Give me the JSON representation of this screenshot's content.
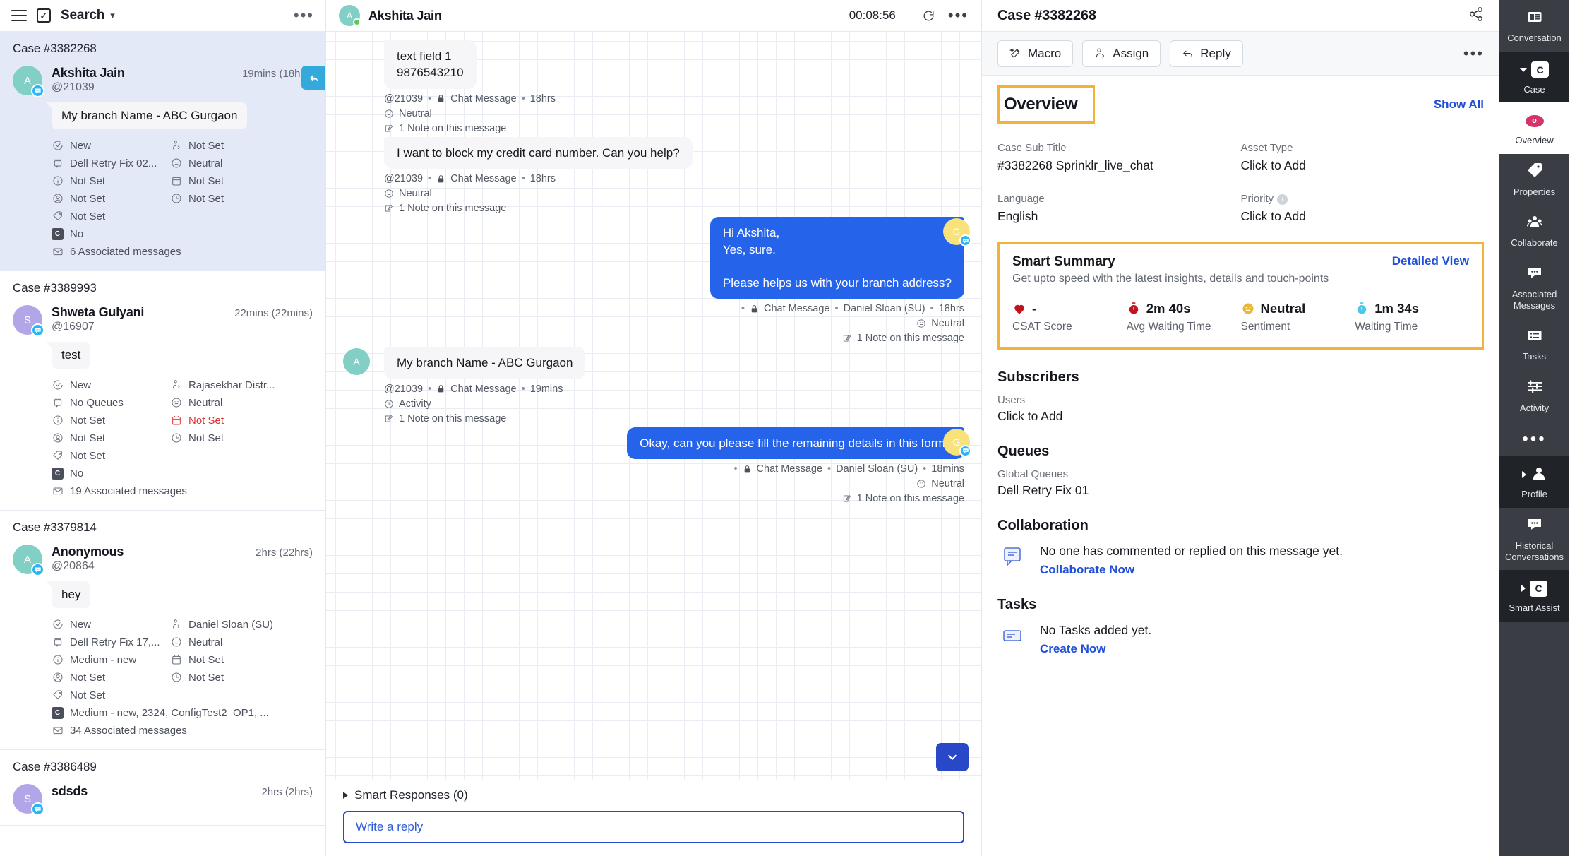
{
  "left": {
    "topbar": {
      "search_label": "Search"
    },
    "cases": [
      {
        "case_id": "Case #3382268",
        "name": "Akshita Jain",
        "handle": "@21039",
        "time": "19mins (18hrs)",
        "initial": "A",
        "avatar_color": "#82cfc6",
        "message": "My branch Name - ABC Gurgaon",
        "meta_left": [
          "New",
          "Dell Retry Fix 02...",
          "Not Set",
          "Not Set",
          "Not Set"
        ],
        "meta_right": [
          "Not Set",
          "Neutral",
          "Not Set",
          "Not Set"
        ],
        "consent": "No",
        "associated": "6 Associated messages",
        "selected": true
      },
      {
        "case_id": "Case #3389993",
        "name": "Shweta Gulyani",
        "handle": "@16907",
        "time": "22mins (22mins)",
        "initial": "S",
        "avatar_color": "#b3a6e8",
        "message": "test",
        "meta_left": [
          "New",
          "No Queues",
          "Not Set",
          "Not Set",
          "Not Set"
        ],
        "meta_right": [
          "Rajasekhar Distr...",
          "Neutral",
          "Not Set",
          "Not Set"
        ],
        "meta_right_red_index": 2,
        "consent": "No",
        "associated": "19 Associated messages",
        "selected": false
      },
      {
        "case_id": "Case #3379814",
        "name": "Anonymous",
        "handle": "@20864",
        "time": "2hrs (22hrs)",
        "initial": "A",
        "avatar_color": "#82cfc6",
        "message": "hey",
        "meta_left": [
          "New",
          "Dell Retry Fix 17,...",
          "Medium - new",
          "Not Set",
          "Not Set"
        ],
        "meta_right": [
          "Daniel Sloan (SU)",
          "Neutral",
          "Not Set",
          "Not Set"
        ],
        "consent": "Medium - new, 2324, ConfigTest2_OP1, ...",
        "associated": "34 Associated messages",
        "selected": false
      },
      {
        "case_id": "Case #3386489",
        "name": "sdsds",
        "handle": "",
        "time": "2hrs (2hrs)",
        "initial": "S",
        "avatar_color": "#b3a6e8",
        "message": "",
        "meta_left": [],
        "meta_right": [],
        "consent": "",
        "associated": "",
        "selected": false
      }
    ]
  },
  "center": {
    "header": {
      "name": "Akshita Jain",
      "initial": "A",
      "timer": "00:08:56"
    },
    "messages": [
      {
        "dir": "in",
        "text": "text field 1\n9876543210",
        "meta": "@21039 • Chat Message • 18hrs",
        "handle": "@21039",
        "channel": "Chat Message",
        "age": "18hrs",
        "sentiment": "Neutral",
        "note": "1 Note on this message",
        "show_avatar": false
      },
      {
        "dir": "in",
        "text": "I want to block my credit card number. Can you help?",
        "handle": "@21039",
        "channel": "Chat Message",
        "age": "18hrs",
        "sentiment": "Neutral",
        "note": "1 Note on this message",
        "show_avatar": false
      },
      {
        "dir": "out",
        "text": "Hi Akshita,\nYes, sure.\n\nPlease helps us with your branch address?",
        "handle": "",
        "channel": "Chat Message",
        "agent": "Daniel Sloan (SU)",
        "age": "18hrs",
        "sentiment": "Neutral",
        "note": "1 Note on this message",
        "show_avatar": true,
        "initial": "G"
      },
      {
        "dir": "in",
        "text": "My branch Name - ABC Gurgaon",
        "handle": "@21039",
        "channel": "Chat Message",
        "age": "19mins",
        "sentiment": "Activity",
        "note": "1 Note on this message",
        "show_avatar": true,
        "initial": "A"
      },
      {
        "dir": "out",
        "text": "Okay, can you please fill the remaining details in this form?",
        "handle": "",
        "channel": "Chat Message",
        "agent": "Daniel Sloan (SU)",
        "age": "18mins",
        "sentiment": "Neutral",
        "note": "1 Note on this message",
        "show_avatar": true,
        "initial": "G"
      }
    ],
    "smart_responses": "Smart Responses (0)",
    "reply_placeholder": "Write a reply"
  },
  "right": {
    "title": "Case #3382268",
    "actions": {
      "macro": "Macro",
      "assign": "Assign",
      "reply": "Reply"
    },
    "overview": {
      "title": "Overview",
      "show_all": "Show All",
      "fields": [
        {
          "label": "Case Sub Title",
          "value": "#3382268 Sprinklr_live_chat"
        },
        {
          "label": "Asset Type",
          "value": "Click to Add"
        },
        {
          "label": "Language",
          "value": "English"
        },
        {
          "label": "Priority",
          "value": "Click to Add",
          "info": true
        }
      ]
    },
    "smart_summary": {
      "title": "Smart Summary",
      "subtitle": "Get upto speed with the latest insights, details and touch-points",
      "link": "Detailed View",
      "stats": [
        {
          "value": "-",
          "label": "CSAT Score",
          "icon": "heart-icon",
          "color": "#c1121f"
        },
        {
          "value": "2m 40s",
          "label": "Avg Waiting Time",
          "icon": "stopwatch-icon",
          "color": "#c1121f"
        },
        {
          "value": "Neutral",
          "label": "Sentiment",
          "icon": "neutral-face-icon",
          "color": "#e8b931"
        },
        {
          "value": "1m 34s",
          "label": "Waiting Time",
          "icon": "stopwatch-icon",
          "color": "#4cc8ea"
        }
      ]
    },
    "subscribers": {
      "heading": "Subscribers",
      "label": "Users",
      "value": "Click to Add"
    },
    "queues": {
      "heading": "Queues",
      "label": "Global Queues",
      "value": "Dell Retry Fix 01"
    },
    "collaboration": {
      "heading": "Collaboration",
      "empty": "No one has commented or replied on this message yet.",
      "link": "Collaborate Now"
    },
    "tasks": {
      "heading": "Tasks",
      "empty": "No Tasks added yet.",
      "link": "Create Now"
    }
  },
  "rail": [
    {
      "label": "Conversation",
      "icon": "conversation-icon",
      "theme": "mid"
    },
    {
      "label": "Case",
      "icon": "case-icon",
      "theme": "dark",
      "caret": "down"
    },
    {
      "label": "Overview",
      "icon": "overview-icon",
      "theme": "light"
    },
    {
      "label": "Properties",
      "icon": "tag-icon",
      "theme": "mid"
    },
    {
      "label": "Collaborate",
      "icon": "people-icon",
      "theme": "mid"
    },
    {
      "label": "Associated Messages",
      "icon": "chat-dots-icon",
      "theme": "mid"
    },
    {
      "label": "Tasks",
      "icon": "list-icon",
      "theme": "mid"
    },
    {
      "label": "Activity",
      "icon": "sliders-icon",
      "theme": "mid"
    },
    {
      "label": "",
      "icon": "more-dots-icon",
      "theme": "mid"
    },
    {
      "label": "Profile",
      "icon": "person-icon",
      "theme": "dark",
      "caret": "right"
    },
    {
      "label": "Historical Conversations",
      "icon": "chat-dots-icon",
      "theme": "mid"
    },
    {
      "label": "Smart Assist",
      "icon": "case-icon",
      "theme": "dark",
      "caret": "right"
    }
  ]
}
